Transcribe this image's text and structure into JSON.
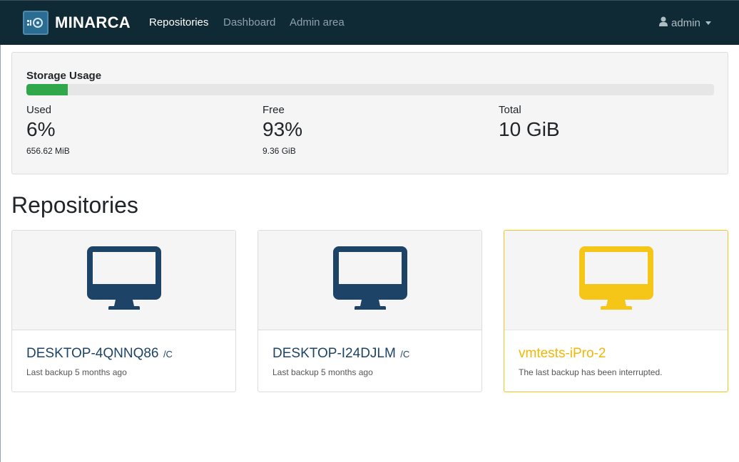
{
  "navbar": {
    "brand": "MINARCA",
    "links": [
      {
        "label": "Repositories",
        "active": true
      },
      {
        "label": "Dashboard",
        "active": false
      },
      {
        "label": "Admin area",
        "active": false
      }
    ],
    "user": "admin"
  },
  "storage": {
    "title": "Storage Usage",
    "used_fraction": 0.06,
    "used": {
      "label": "Used",
      "value": "6%",
      "sub": "656.62 MiB"
    },
    "free": {
      "label": "Free",
      "value": "93%",
      "sub": "9.36 GiB"
    },
    "total": {
      "label": "Total",
      "value": "10 GiB"
    },
    "bar_color": "#2fa74a"
  },
  "repositories": {
    "title": "Repositories",
    "items": [
      {
        "name": "DESKTOP-4QNNQ86",
        "path": "/C",
        "status": "Last backup 5 months ago",
        "icon": "desktop-icon",
        "color": "#1d4466"
      },
      {
        "name": "DESKTOP-I24DJLM",
        "path": "/C",
        "status": "Last backup 5 months ago",
        "icon": "desktop-icon",
        "color": "#1d4466"
      },
      {
        "name": "vmtests-iPro-2",
        "path": "",
        "status": "The last backup has been interrupted.",
        "icon": "desktop-icon",
        "color": "#f5c518"
      }
    ]
  }
}
